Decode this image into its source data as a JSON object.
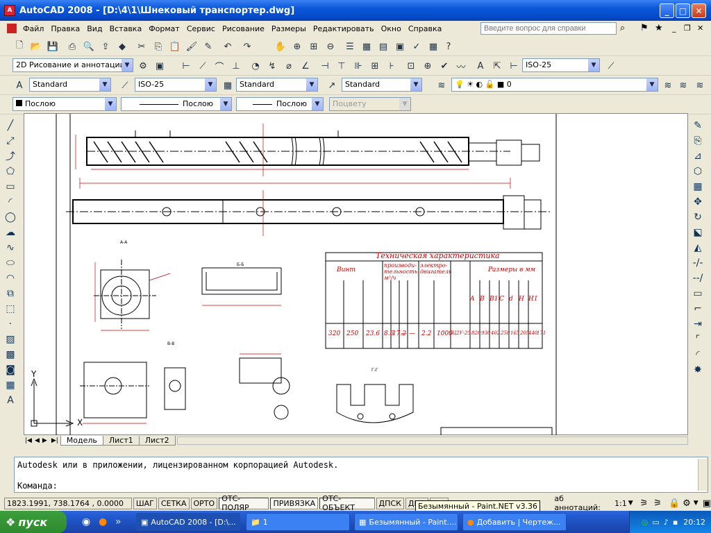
{
  "window": {
    "title": "AutoCAD 2008 - [D:\\4\\1\\Шнековый транспортер.dwg]"
  },
  "menu": {
    "items": [
      "Файл",
      "Правка",
      "Вид",
      "Вставка",
      "Формат",
      "Сервис",
      "Рисование",
      "Размеры",
      "Редактировать",
      "Окно",
      "Справка"
    ],
    "help_placeholder": "Введите вопрос для справки"
  },
  "toolbars": {
    "workspace": "2D Рисование и аннотации",
    "dimstyle_top": "ISO-25",
    "textstyle": "Standard",
    "dimstyle": "ISO-25",
    "tablestyle": "Standard",
    "mleaderstyle": "Standard",
    "layer": "0",
    "color": "Послою",
    "linetype": "Послою",
    "lineweight": "Послою",
    "plotstyle": "Поцвету"
  },
  "drawing": {
    "title_tech": "Техническая характеристика",
    "header_screw": "Винт",
    "header_capacity": "производи- тельность м³/ч",
    "header_motor": "электро- двигатель",
    "header_dims": "Размеры в мм",
    "cols_dims": [
      "A",
      "B",
      "B1",
      "C",
      "d",
      "H",
      "H1"
    ],
    "row_values": [
      "320",
      "250",
      "23.6",
      "8.6",
      "17.2",
      "—",
      "—",
      "2.2",
      "1000",
      "Ц2У-25",
      "820",
      "930",
      "402",
      "250",
      "165",
      "205",
      "440",
      "171"
    ],
    "section_labels": [
      "А-А",
      "Б-Б",
      "В-В",
      "Г-Г"
    ],
    "axis_y": "Y",
    "axis_x": "X"
  },
  "tabs": [
    "Модель",
    "Лист1",
    "Лист2"
  ],
  "command": {
    "line1": "Autodesk или в приложении, лицензированном корпорацией Autodesk.",
    "prompt": "Команда:"
  },
  "status": {
    "coords": "1823.1991, 738.1764 , 0.0000",
    "buttons": [
      "ШАГ",
      "СЕТКА",
      "ОРТО",
      "ОТС-ПОЛЯР",
      "ПРИВЯЗКА",
      "ОТС-ОБЪЕКТ",
      "ДПСК",
      "ДИН",
      "ВЕС"
    ],
    "scale_label": "аб аннотаций:",
    "scale_value": "1:1"
  },
  "tooltip": "Безымянный - Paint.NET v3.36",
  "taskbar": {
    "start": "пуск",
    "tasks": [
      "AutoCAD 2008 - [D:\\...",
      "1",
      "Безымянный - Paint....",
      "Добавить | Чертеж..."
    ],
    "clock": "20:12"
  },
  "colors": {
    "drawing_red": "#cc0000",
    "xp_blue": "#245ed7"
  }
}
